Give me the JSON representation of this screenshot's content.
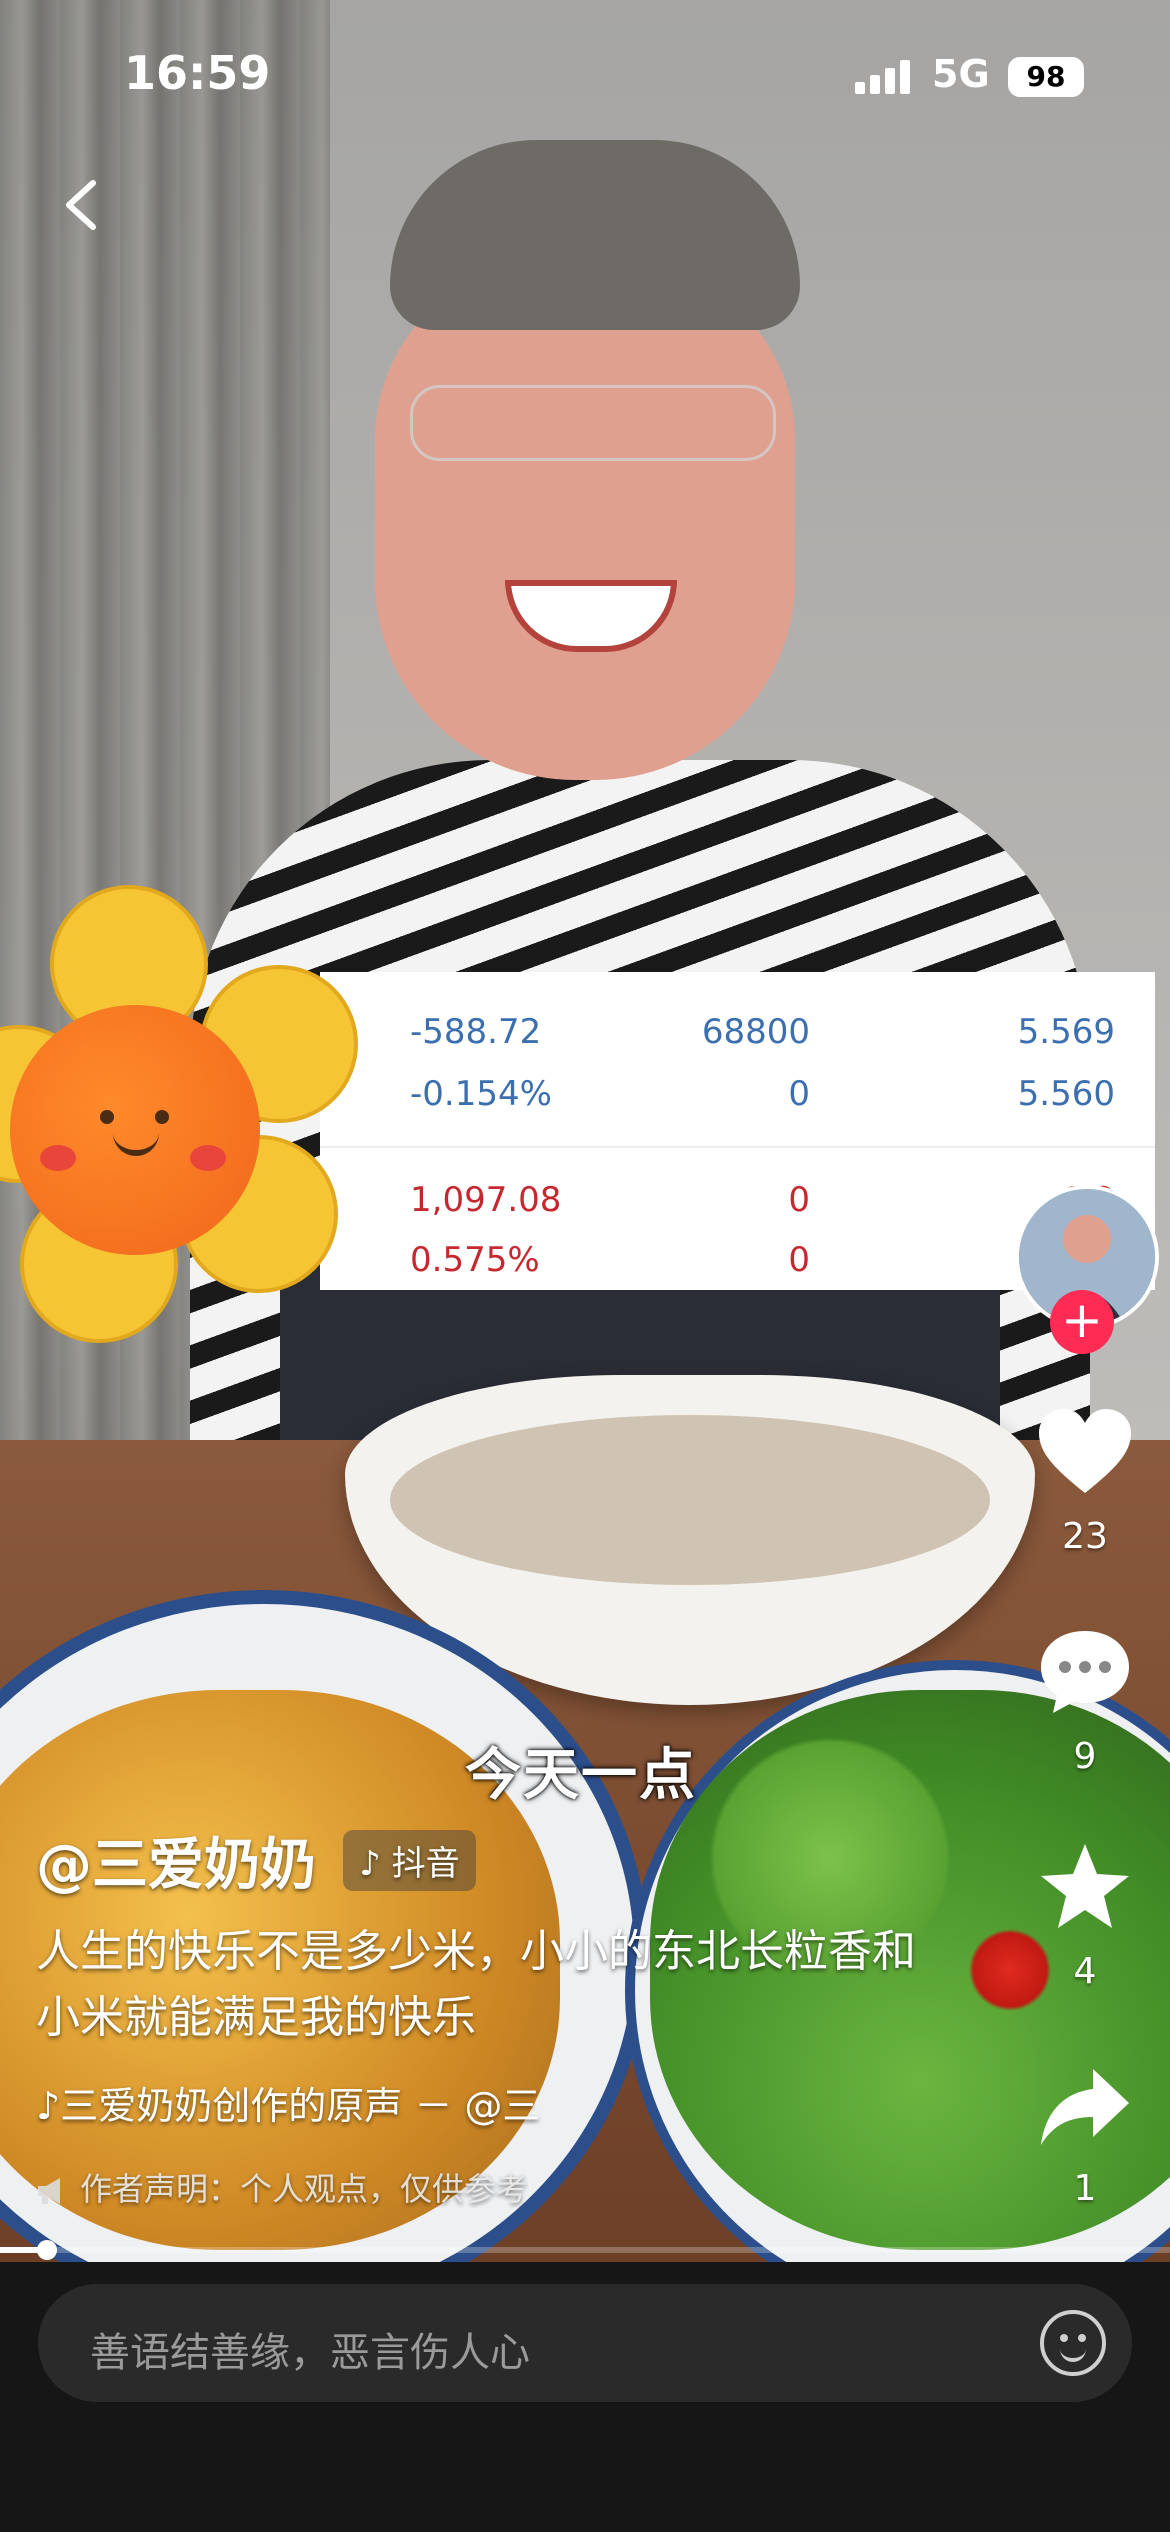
{
  "status_bar": {
    "time": "16:59",
    "network": "5G",
    "battery": "98"
  },
  "stock_panel": {
    "rows": [
      {
        "a": "-588.72",
        "b": "68800",
        "c": "5.569",
        "color": "#3b6fb0"
      },
      {
        "a": "-0.154%",
        "b": "0",
        "c": "5.560",
        "color": "#3b6fb0"
      },
      {
        "a": "1,097.08",
        "b": "0",
        "c": "6.2",
        "color": "#c6282f"
      },
      {
        "a": "0.575%",
        "b": "0",
        "c": "",
        "color": "#c6282f"
      }
    ]
  },
  "rail": {
    "likes": "23",
    "comments": "9",
    "favorites": "4",
    "shares": "1"
  },
  "video": {
    "subtitle": "今天一点",
    "author": "@三爱奶奶",
    "platform_badge": "抖音",
    "description": "人生的快乐不是多少米，小小的东北长粒香和小米就能满足我的快乐",
    "music": "♪三爱奶奶创作的原声 － @三",
    "declaration": "作者声明：个人观点，仅供参考",
    "progress": 0.04
  },
  "comment_bar": {
    "placeholder": "善语结善缘，恶言伤人心"
  },
  "icons": {
    "back": "back-arrow-icon",
    "like": "heart-icon",
    "comment": "comment-bubble-icon",
    "favorite": "star-icon",
    "share": "share-arrow-icon",
    "emoji": "emoji-icon",
    "declare": "megaphone-icon"
  },
  "colors": {
    "accent": "#fe2c55"
  }
}
